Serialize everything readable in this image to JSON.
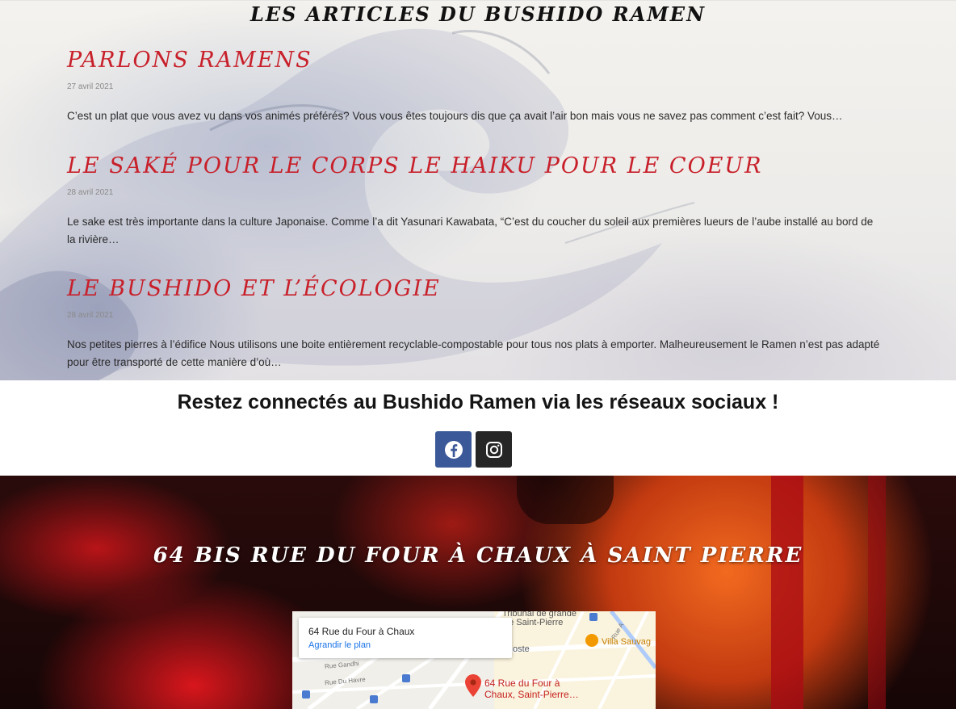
{
  "articles_section": {
    "title": "Les articles du Bushido Ramen",
    "articles": [
      {
        "title": "Parlons Ramens",
        "date": "27 avril 2021",
        "excerpt": "C’est un plat que vous avez vu dans vos animés préférés? Vous vous êtes toujours dis que ça avait l’air bon mais vous ne savez pas comment c’est fait?  Vous…"
      },
      {
        "title": "Le saké pour le corps le haiku pour le coeur",
        "date": "28 avril 2021",
        "excerpt": "Le sake est très importante dans la culture Japonaise. Comme l’a dit  Yasunari Kawabata, “C’est du coucher du soleil aux premières lueurs de l’aube installé au bord de la rivière…"
      },
      {
        "title": "Le Bushido et l’écologie",
        "date": "28 avril 2021",
        "excerpt": "Nos petites pierres à l’édifice Nous utilisons une boite entièrement recyclable-compostable pour tous nos plats à emporter.  Malheureusement le Ramen n’est pas adapté pour être transporté de cette manière d’où…"
      }
    ]
  },
  "social": {
    "heading": "Restez connectés au Bushido Ramen via les réseaux sociaux !",
    "buttons": [
      {
        "name": "facebook",
        "icon": "facebook-icon",
        "color": "#3b5998"
      },
      {
        "name": "instagram",
        "icon": "instagram-icon",
        "color": "#262626"
      }
    ]
  },
  "address_section": {
    "title": "64 Bis rue du four à chaux à Saint Pierre",
    "map": {
      "card_title": "64 Rue du Four à Chaux",
      "card_link": "Agrandir le plan",
      "pin_label_line1": "64 Rue du Four à",
      "pin_label_line2": "Chaux, Saint-Pierre…",
      "place_1": "Tribunal de grande",
      "place_1b": "de Saint-Pierre",
      "place_2": "Villa Sauvag",
      "place_3": "oste",
      "street_1": "Rue Gandhi",
      "street_2": "Rue Du Havre",
      "street_3": "Rue A"
    }
  },
  "colors": {
    "accent_red": "#c8202a",
    "facebook": "#3b5998",
    "instagram": "#262626"
  }
}
